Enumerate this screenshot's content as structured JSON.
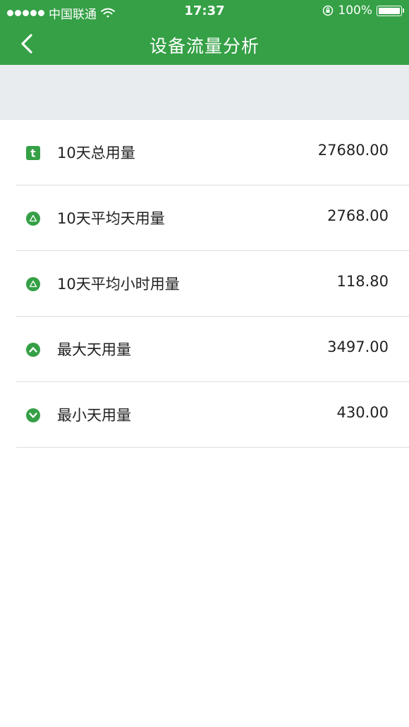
{
  "status_bar": {
    "carrier": "中国联通",
    "time": "17:37",
    "battery": "100%"
  },
  "nav": {
    "title": "设备流量分析"
  },
  "stats": [
    {
      "label": "10天总用量",
      "value": "27680.00",
      "icon": "total-usage-icon"
    },
    {
      "label": "10天平均天用量",
      "value": "2768.00",
      "icon": "average-triangle-icon"
    },
    {
      "label": "10天平均小时用量",
      "value": "118.80",
      "icon": "average-triangle-icon"
    },
    {
      "label": "最大天用量",
      "value": "3497.00",
      "icon": "chevron-up-circle-icon"
    },
    {
      "label": "最小天用量",
      "value": "430.00",
      "icon": "chevron-down-circle-icon"
    }
  ],
  "colors": {
    "primary_green": "#35a046",
    "band_gray": "#e8ecee"
  }
}
